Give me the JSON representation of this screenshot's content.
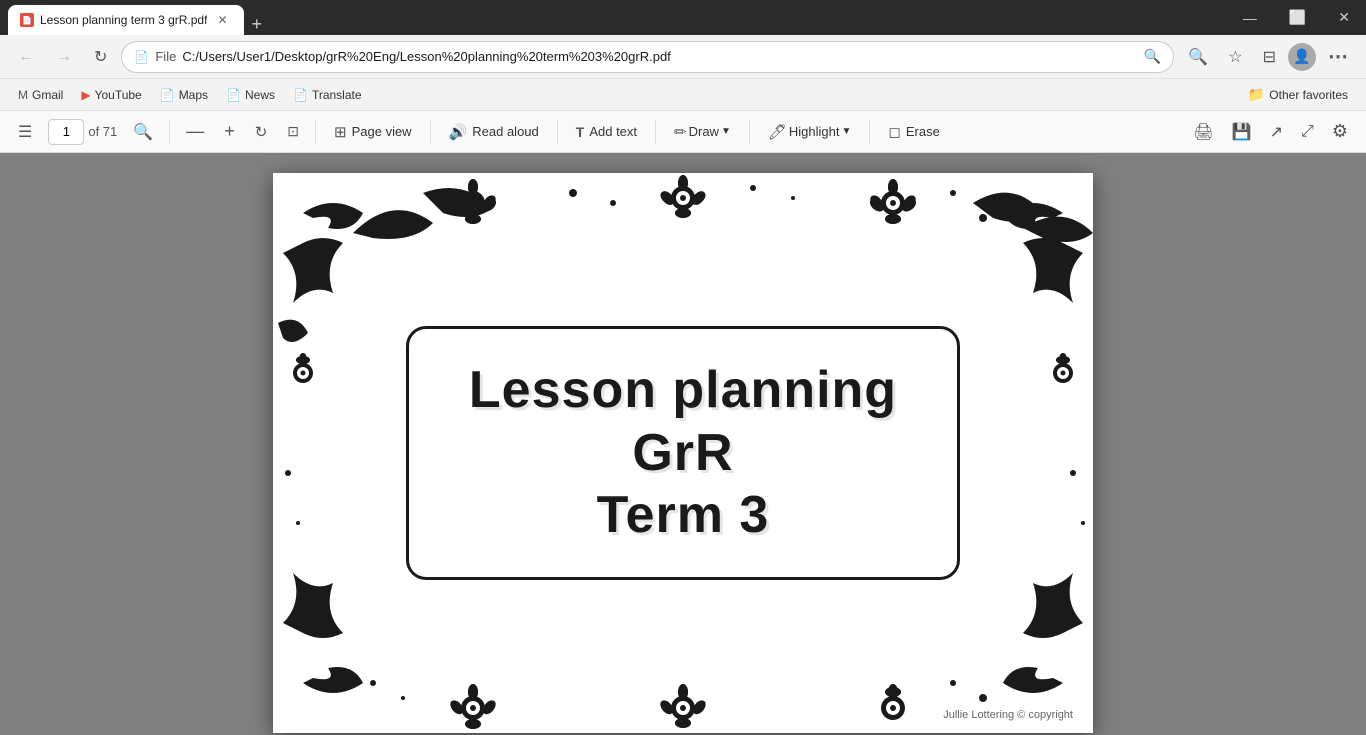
{
  "titleBar": {
    "tab": {
      "title": "Lesson planning term 3 grR.pdf",
      "favicon": "📄"
    },
    "closeBtn": "✕",
    "minimizeBtn": "—",
    "maximizeBtn": "⬜",
    "newTabIcon": "+"
  },
  "navBar": {
    "backBtn": "←",
    "forwardBtn": "→",
    "refreshBtn": "↻",
    "fileLabel": "File",
    "addressText": "C:/Users/User1/Desktop/grR%20Eng/Lesson%20planning%20term%203%20grR.pdf",
    "searchIcon": "🔍",
    "favoritesIcon": "★",
    "collectionIcon": "☰",
    "profileIcon": "👤",
    "moreBtn": "⋯"
  },
  "bookmarksBar": {
    "items": [
      {
        "label": "Gmail",
        "icon": "M"
      },
      {
        "label": "YouTube",
        "icon": "▶"
      },
      {
        "label": "Maps",
        "icon": "📄"
      },
      {
        "label": "News",
        "icon": "📄"
      },
      {
        "label": "Translate",
        "icon": "📄"
      }
    ],
    "otherFavorites": "Other favorites",
    "folderIcon": "📁"
  },
  "pdfToolbar": {
    "sidebarIcon": "☰",
    "pageNumber": "1",
    "pageTotal": "of 71",
    "searchIcon": "🔍",
    "zoomOutIcon": "—",
    "zoomInIcon": "+",
    "rotateIcon": "↻",
    "fitPageIcon": "⊡",
    "pageViewLabel": "Page view",
    "pageViewIcon": "⊞",
    "readAloudLabel": "Read aloud",
    "readAloudIcon": "🔊",
    "addTextLabel": "Add text",
    "addTextIcon": "T",
    "drawLabel": "Draw",
    "drawIcon": "✏",
    "highlightLabel": "Highlight",
    "highlightIcon": "🖊",
    "eraseLabel": "Erase",
    "eraseIcon": "◻",
    "printIcon": "🖨",
    "saveIcon": "💾",
    "shareIcon": "↗",
    "expandIcon": "⤢",
    "settingsIcon": "⚙"
  },
  "pdfContent": {
    "titleLine1": "Lesson planning",
    "titleLine2": "GrR",
    "titleLine3": "Term 3",
    "copyright": "Jullie Lottering © copyright"
  }
}
